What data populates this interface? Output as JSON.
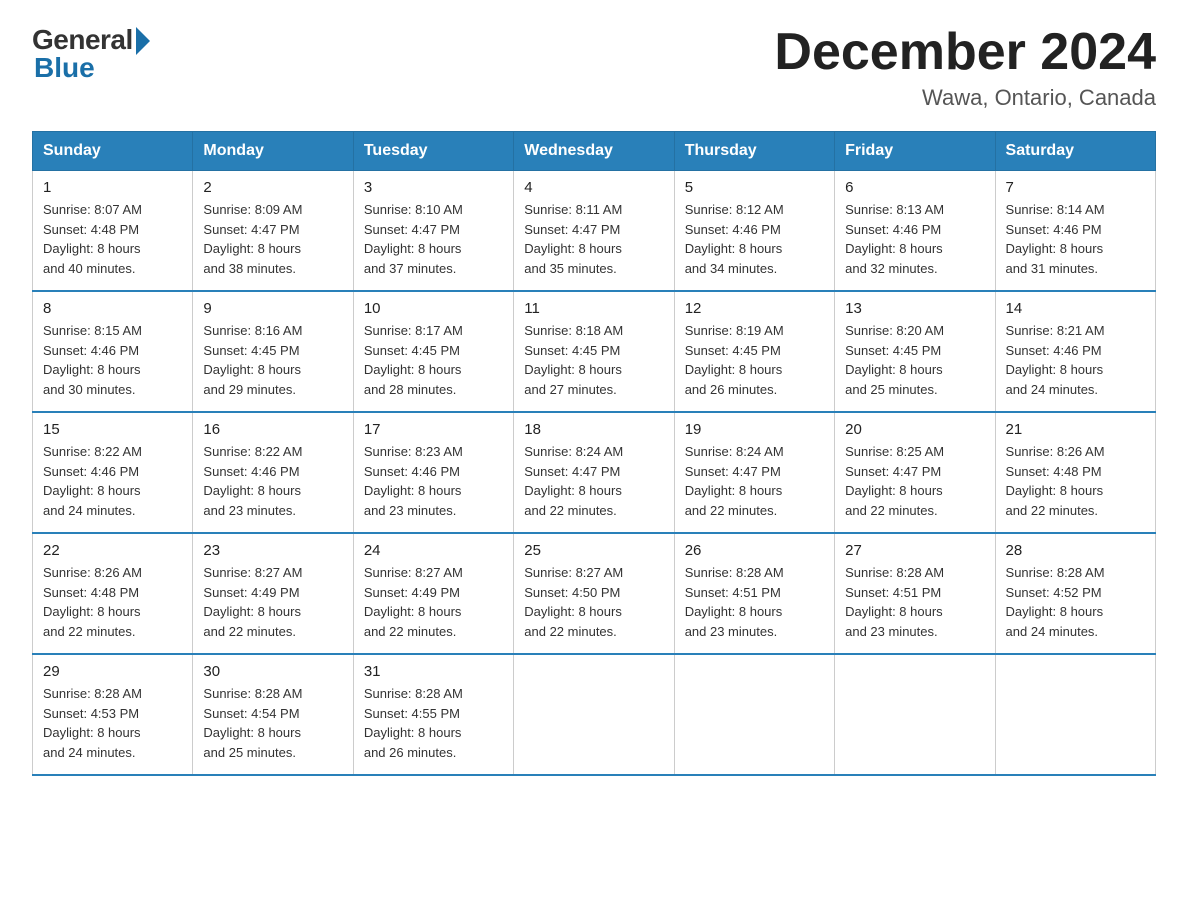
{
  "logo": {
    "general": "General",
    "blue": "Blue"
  },
  "title": "December 2024",
  "location": "Wawa, Ontario, Canada",
  "days_of_week": [
    "Sunday",
    "Monday",
    "Tuesday",
    "Wednesday",
    "Thursday",
    "Friday",
    "Saturday"
  ],
  "weeks": [
    [
      {
        "day": "1",
        "sunrise": "8:07 AM",
        "sunset": "4:48 PM",
        "daylight": "8 hours and 40 minutes."
      },
      {
        "day": "2",
        "sunrise": "8:09 AM",
        "sunset": "4:47 PM",
        "daylight": "8 hours and 38 minutes."
      },
      {
        "day": "3",
        "sunrise": "8:10 AM",
        "sunset": "4:47 PM",
        "daylight": "8 hours and 37 minutes."
      },
      {
        "day": "4",
        "sunrise": "8:11 AM",
        "sunset": "4:47 PM",
        "daylight": "8 hours and 35 minutes."
      },
      {
        "day": "5",
        "sunrise": "8:12 AM",
        "sunset": "4:46 PM",
        "daylight": "8 hours and 34 minutes."
      },
      {
        "day": "6",
        "sunrise": "8:13 AM",
        "sunset": "4:46 PM",
        "daylight": "8 hours and 32 minutes."
      },
      {
        "day": "7",
        "sunrise": "8:14 AM",
        "sunset": "4:46 PM",
        "daylight": "8 hours and 31 minutes."
      }
    ],
    [
      {
        "day": "8",
        "sunrise": "8:15 AM",
        "sunset": "4:46 PM",
        "daylight": "8 hours and 30 minutes."
      },
      {
        "day": "9",
        "sunrise": "8:16 AM",
        "sunset": "4:45 PM",
        "daylight": "8 hours and 29 minutes."
      },
      {
        "day": "10",
        "sunrise": "8:17 AM",
        "sunset": "4:45 PM",
        "daylight": "8 hours and 28 minutes."
      },
      {
        "day": "11",
        "sunrise": "8:18 AM",
        "sunset": "4:45 PM",
        "daylight": "8 hours and 27 minutes."
      },
      {
        "day": "12",
        "sunrise": "8:19 AM",
        "sunset": "4:45 PM",
        "daylight": "8 hours and 26 minutes."
      },
      {
        "day": "13",
        "sunrise": "8:20 AM",
        "sunset": "4:45 PM",
        "daylight": "8 hours and 25 minutes."
      },
      {
        "day": "14",
        "sunrise": "8:21 AM",
        "sunset": "4:46 PM",
        "daylight": "8 hours and 24 minutes."
      }
    ],
    [
      {
        "day": "15",
        "sunrise": "8:22 AM",
        "sunset": "4:46 PM",
        "daylight": "8 hours and 24 minutes."
      },
      {
        "day": "16",
        "sunrise": "8:22 AM",
        "sunset": "4:46 PM",
        "daylight": "8 hours and 23 minutes."
      },
      {
        "day": "17",
        "sunrise": "8:23 AM",
        "sunset": "4:46 PM",
        "daylight": "8 hours and 23 minutes."
      },
      {
        "day": "18",
        "sunrise": "8:24 AM",
        "sunset": "4:47 PM",
        "daylight": "8 hours and 22 minutes."
      },
      {
        "day": "19",
        "sunrise": "8:24 AM",
        "sunset": "4:47 PM",
        "daylight": "8 hours and 22 minutes."
      },
      {
        "day": "20",
        "sunrise": "8:25 AM",
        "sunset": "4:47 PM",
        "daylight": "8 hours and 22 minutes."
      },
      {
        "day": "21",
        "sunrise": "8:26 AM",
        "sunset": "4:48 PM",
        "daylight": "8 hours and 22 minutes."
      }
    ],
    [
      {
        "day": "22",
        "sunrise": "8:26 AM",
        "sunset": "4:48 PM",
        "daylight": "8 hours and 22 minutes."
      },
      {
        "day": "23",
        "sunrise": "8:27 AM",
        "sunset": "4:49 PM",
        "daylight": "8 hours and 22 minutes."
      },
      {
        "day": "24",
        "sunrise": "8:27 AM",
        "sunset": "4:49 PM",
        "daylight": "8 hours and 22 minutes."
      },
      {
        "day": "25",
        "sunrise": "8:27 AM",
        "sunset": "4:50 PM",
        "daylight": "8 hours and 22 minutes."
      },
      {
        "day": "26",
        "sunrise": "8:28 AM",
        "sunset": "4:51 PM",
        "daylight": "8 hours and 23 minutes."
      },
      {
        "day": "27",
        "sunrise": "8:28 AM",
        "sunset": "4:51 PM",
        "daylight": "8 hours and 23 minutes."
      },
      {
        "day": "28",
        "sunrise": "8:28 AM",
        "sunset": "4:52 PM",
        "daylight": "8 hours and 24 minutes."
      }
    ],
    [
      {
        "day": "29",
        "sunrise": "8:28 AM",
        "sunset": "4:53 PM",
        "daylight": "8 hours and 24 minutes."
      },
      {
        "day": "30",
        "sunrise": "8:28 AM",
        "sunset": "4:54 PM",
        "daylight": "8 hours and 25 minutes."
      },
      {
        "day": "31",
        "sunrise": "8:28 AM",
        "sunset": "4:55 PM",
        "daylight": "8 hours and 26 minutes."
      },
      null,
      null,
      null,
      null
    ]
  ],
  "labels": {
    "sunrise": "Sunrise:",
    "sunset": "Sunset:",
    "daylight": "Daylight:"
  }
}
